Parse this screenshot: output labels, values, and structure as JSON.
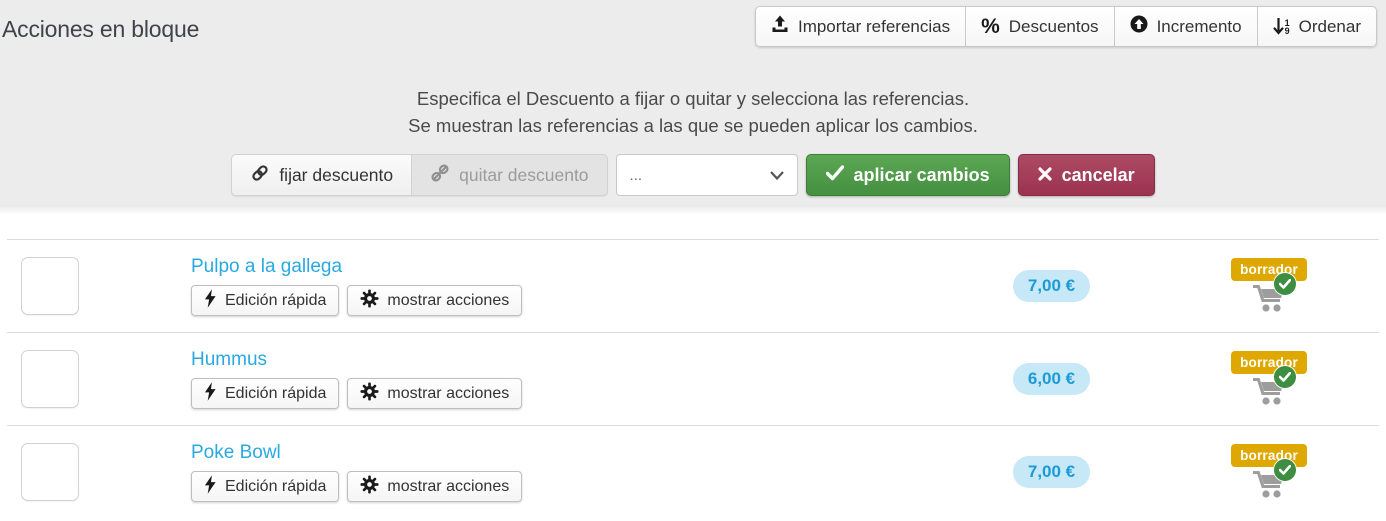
{
  "page": {
    "title": "Acciones en bloque"
  },
  "toolbar": {
    "import_label": "Importar referencias",
    "discounts_label": "Descuentos",
    "increment_label": "Incremento",
    "sort_label": "Ordenar",
    "sort_digit_top": "1",
    "sort_digit_bottom": "9"
  },
  "icons": {
    "percent": "%"
  },
  "panel": {
    "instruction_line1": "Especifica el Descuento a fijar o quitar y selecciona las referencias.",
    "instruction_line2": "Se muestran las referencias a las que se pueden aplicar los cambios.",
    "set_discount_label": "fijar descuento",
    "remove_discount_label": "quitar descuento",
    "discount_select_value": "...",
    "apply_label": "aplicar cambios",
    "cancel_label": "cancelar"
  },
  "row_actions": {
    "quick_edit_label": "Edición rápida",
    "show_actions_label": "mostrar acciones"
  },
  "rows": [
    {
      "name": "Pulpo a la gallega",
      "price": "7,00 €",
      "status": "borrador"
    },
    {
      "name": "Hummus",
      "price": "6,00 €",
      "status": "borrador"
    },
    {
      "name": "Poke Bowl",
      "price": "7,00 €",
      "status": "borrador"
    }
  ],
  "colors": {
    "header_bg": "#ececec",
    "link_blue": "#29a9e0",
    "price_pill_bg": "#c6e8f7",
    "price_text": "#1c9ad6",
    "status_badge_bg": "#dfa800",
    "apply_green": "#459041",
    "cancel_red": "#9b3350",
    "cart_gray": "#9d9d9d",
    "cart_check_green": "#3e8e41"
  }
}
